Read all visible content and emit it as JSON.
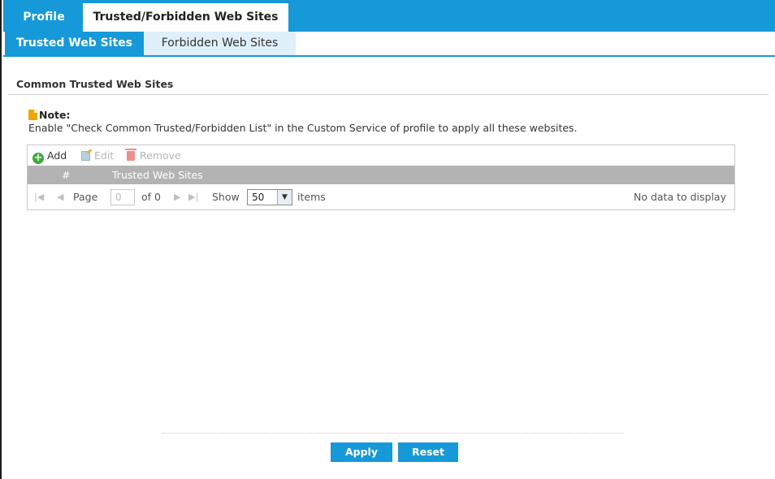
{
  "top_tabs": [
    {
      "label": "Profile"
    },
    {
      "label": "Trusted/Forbidden Web Sites"
    }
  ],
  "sub_tabs": [
    {
      "label": "Trusted Web Sites"
    },
    {
      "label": "Forbidden Web Sites"
    }
  ],
  "section": {
    "title": "Common Trusted Web Sites"
  },
  "note": {
    "title": "Note:",
    "text": "Enable \"Check Common Trusted/Forbidden List\" in the Custom Service of profile to apply all these websites."
  },
  "toolbar": {
    "add": "Add",
    "edit": "Edit",
    "remove": "Remove"
  },
  "table": {
    "columns": [
      "#",
      "Trusted Web Sites"
    ],
    "rows": []
  },
  "pager": {
    "page_label": "Page",
    "page_value": "0",
    "of_label": "of 0",
    "show_label": "Show",
    "show_value": "50",
    "items_label": "items",
    "empty_text": "No data to display"
  },
  "buttons": {
    "apply": "Apply",
    "reset": "Reset"
  },
  "colors": {
    "accent": "#1699d8",
    "header_gray": "#b3b3b3",
    "add_green": "#3caa3c"
  }
}
